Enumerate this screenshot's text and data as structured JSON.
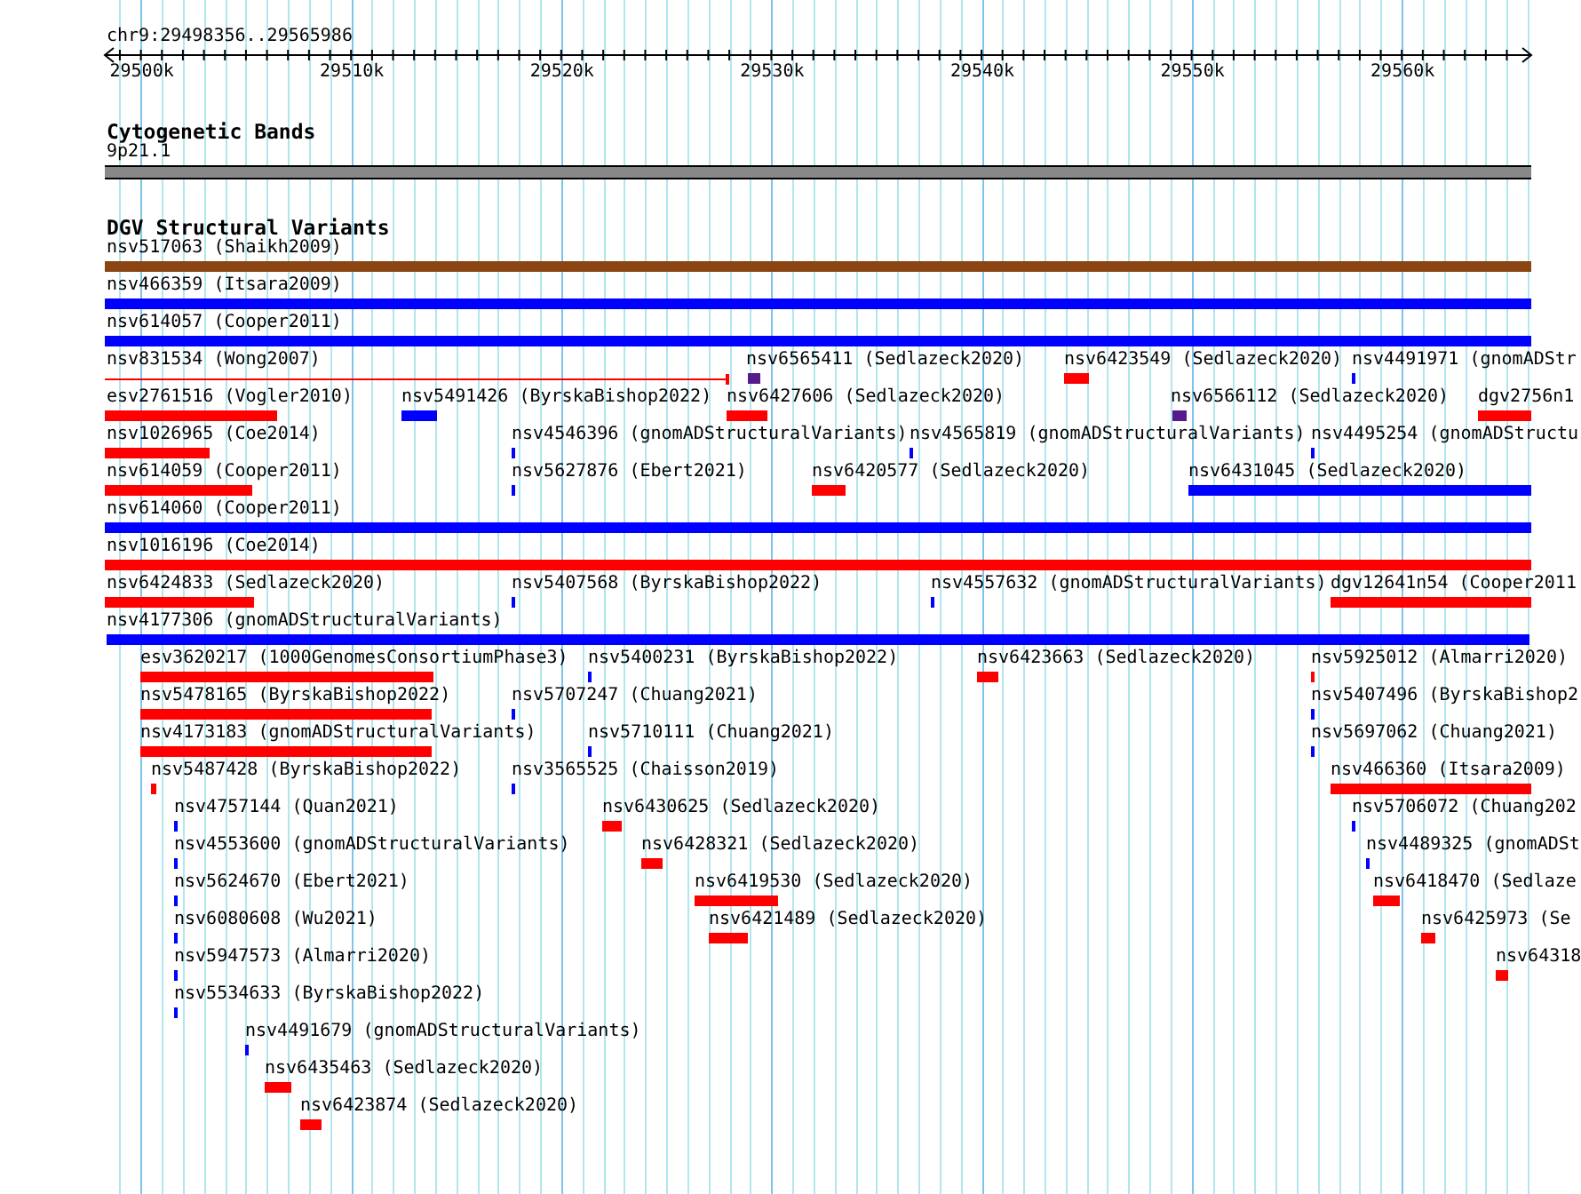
{
  "ruler": {
    "position": "chr9:29498356..29565986",
    "ticks": [
      "29500k",
      "29510k",
      "29520k",
      "29530k",
      "29540k",
      "29550k",
      "29560k"
    ]
  },
  "tracks": [
    {
      "title": "Cytogenetic Bands",
      "features": [
        {
          "label": "9p21.1",
          "kind": "band",
          "color": "#888888"
        }
      ]
    },
    {
      "title": "DGV Structural Variants",
      "features": [
        {
          "label": "nsv517063 (Shaikh2009)",
          "kind": "bar",
          "color": "#8b4513"
        },
        {
          "label": "nsv466359 (Itsara2009)",
          "kind": "bar",
          "color": "#0000ff"
        },
        {
          "label": "nsv614057 (Cooper2011)",
          "kind": "bar",
          "color": "#0000ff"
        },
        {
          "label": "nsv831534 (Wong2007)",
          "kind": "line",
          "color": "#ff0000"
        },
        {
          "label": "nsv6565411 (Sedlazeck2020)",
          "kind": "bar",
          "color": "#551a8b"
        },
        {
          "label": "nsv6423549 (Sedlazeck2020)",
          "kind": "bar",
          "color": "#ff0000"
        },
        {
          "label": "nsv4491971 (gnomADStr",
          "kind": "bar",
          "color": "#0000ff"
        },
        {
          "label": "esv2761516 (Vogler2010)",
          "kind": "bar",
          "color": "#ff0000"
        },
        {
          "label": "nsv5491426 (ByrskaBishop2022)",
          "kind": "bar",
          "color": "#0000ff"
        },
        {
          "label": "nsv6427606 (Sedlazeck2020)",
          "kind": "bar",
          "color": "#ff0000"
        },
        {
          "label": "nsv6566112 (Sedlazeck2020)",
          "kind": "bar",
          "color": "#551a8b"
        },
        {
          "label": "dgv2756n1",
          "kind": "bar",
          "color": "#ff0000"
        },
        {
          "label": "nsv1026965 (Coe2014)",
          "kind": "bar",
          "color": "#ff0000"
        },
        {
          "label": "nsv4546396 (gnomADStructuralVariants)",
          "kind": "bar",
          "color": "#0000ff"
        },
        {
          "label": "nsv4565819 (gnomADStructuralVariants)",
          "kind": "bar",
          "color": "#0000ff"
        },
        {
          "label": "nsv4495254 (gnomADStructu",
          "kind": "bar",
          "color": "#0000ff"
        },
        {
          "label": "nsv614059 (Cooper2011)",
          "kind": "bar",
          "color": "#ff0000"
        },
        {
          "label": "nsv5627876 (Ebert2021)",
          "kind": "bar",
          "color": "#0000ff"
        },
        {
          "label": "nsv6420577 (Sedlazeck2020)",
          "kind": "bar",
          "color": "#ff0000"
        },
        {
          "label": "nsv6431045 (Sedlazeck2020)",
          "kind": "bar",
          "color": "#0000ff"
        },
        {
          "label": "nsv614060 (Cooper2011)",
          "kind": "bar",
          "color": "#0000ff"
        },
        {
          "label": "nsv1016196 (Coe2014)",
          "kind": "bar",
          "color": "#ff0000"
        },
        {
          "label": "nsv6424833 (Sedlazeck2020)",
          "kind": "bar",
          "color": "#ff0000"
        },
        {
          "label": "nsv5407568 (ByrskaBishop2022)",
          "kind": "bar",
          "color": "#0000ff"
        },
        {
          "label": "nsv4557632 (gnomADStructuralVariants)",
          "kind": "bar",
          "color": "#0000ff"
        },
        {
          "label": "dgv12641n54 (Cooper2011",
          "kind": "bar",
          "color": "#ff0000"
        },
        {
          "label": "nsv4177306 (gnomADStructuralVariants)",
          "kind": "bar",
          "color": "#0000ff"
        },
        {
          "label": "esv3620217 (1000GenomesConsortiumPhase3)",
          "kind": "bar",
          "color": "#ff0000"
        },
        {
          "label": "nsv5400231 (ByrskaBishop2022)",
          "kind": "bar",
          "color": "#0000ff"
        },
        {
          "label": "nsv6423663 (Sedlazeck2020)",
          "kind": "bar",
          "color": "#ff0000"
        },
        {
          "label": "nsv5925012 (Almarri2020)",
          "kind": "bar",
          "color": "#ff0000"
        },
        {
          "label": "nsv5478165 (ByrskaBishop2022)",
          "kind": "bar",
          "color": "#ff0000"
        },
        {
          "label": "nsv5707247 (Chuang2021)",
          "kind": "bar",
          "color": "#0000ff"
        },
        {
          "label": "nsv5407496 (ByrskaBishop2",
          "kind": "bar",
          "color": "#0000ff"
        },
        {
          "label": "nsv4173183 (gnomADStructuralVariants)",
          "kind": "bar",
          "color": "#ff0000"
        },
        {
          "label": "nsv5710111 (Chuang2021)",
          "kind": "bar",
          "color": "#0000ff"
        },
        {
          "label": "nsv5697062 (Chuang2021)",
          "kind": "bar",
          "color": "#0000ff"
        },
        {
          "label": "nsv5487428 (ByrskaBishop2022)",
          "kind": "bar",
          "color": "#ff0000"
        },
        {
          "label": "nsv3565525 (Chaisson2019)",
          "kind": "bar",
          "color": "#0000ff"
        },
        {
          "label": "nsv466360 (Itsara2009)",
          "kind": "bar",
          "color": "#ff0000"
        },
        {
          "label": "nsv4757144 (Quan2021)",
          "kind": "bar",
          "color": "#0000ff"
        },
        {
          "label": "nsv6430625 (Sedlazeck2020)",
          "kind": "bar",
          "color": "#ff0000"
        },
        {
          "label": "nsv5706072 (Chuang202",
          "kind": "bar",
          "color": "#0000ff"
        },
        {
          "label": "nsv4553600 (gnomADStructuralVariants)",
          "kind": "bar",
          "color": "#0000ff"
        },
        {
          "label": "nsv6428321 (Sedlazeck2020)",
          "kind": "bar",
          "color": "#ff0000"
        },
        {
          "label": "nsv4489325 (gnomADSt",
          "kind": "bar",
          "color": "#0000ff"
        },
        {
          "label": "nsv5624670 (Ebert2021)",
          "kind": "bar",
          "color": "#0000ff"
        },
        {
          "label": "nsv6419530 (Sedlazeck2020)",
          "kind": "bar",
          "color": "#ff0000"
        },
        {
          "label": "nsv6418470 (Sedlaze",
          "kind": "bar",
          "color": "#ff0000"
        },
        {
          "label": "nsv6080608 (Wu2021)",
          "kind": "bar",
          "color": "#0000ff"
        },
        {
          "label": "nsv6421489 (Sedlazeck2020)",
          "kind": "bar",
          "color": "#ff0000"
        },
        {
          "label": "nsv6425973 (Se",
          "kind": "bar",
          "color": "#ff0000"
        },
        {
          "label": "nsv5947573 (Almarri2020)",
          "kind": "bar",
          "color": "#0000ff"
        },
        {
          "label": "nsv64318",
          "kind": "bar",
          "color": "#ff0000"
        },
        {
          "label": "nsv5534633 (ByrskaBishop2022)",
          "kind": "bar",
          "color": "#0000ff"
        },
        {
          "label": "nsv4491679 (gnomADStructuralVariants)",
          "kind": "bar",
          "color": "#0000ff"
        },
        {
          "label": "nsv6435463 (Sedlazeck2020)",
          "kind": "bar",
          "color": "#ff0000"
        },
        {
          "label": "nsv6423874 (Sedlazeck2020)",
          "kind": "bar",
          "color": "#ff0000"
        }
      ]
    }
  ]
}
